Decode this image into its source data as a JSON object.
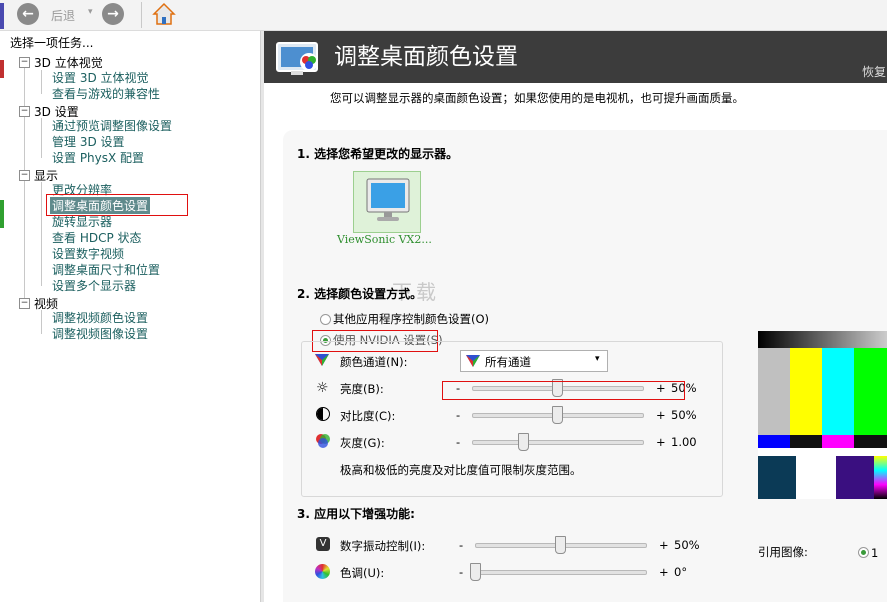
{
  "toolbar": {
    "back_label": "后退"
  },
  "left": {
    "header": "选择一项任务...",
    "categories": [
      {
        "label": "3D 立体视觉",
        "items": [
          "设置 3D 立体视觉",
          "查看与游戏的兼容性"
        ]
      },
      {
        "label": "3D 设置",
        "items": [
          "通过预览调整图像设置",
          "管理 3D 设置",
          "设置 PhysX 配置"
        ]
      },
      {
        "label": "显示",
        "items": [
          "更改分辨率",
          "调整桌面颜色设置",
          "旋转显示器",
          "查看 HDCP 状态",
          "设置数字视频",
          "调整桌面尺寸和位置",
          "设置多个显示器"
        ]
      },
      {
        "label": "视频",
        "items": [
          "调整视频颜色设置",
          "调整视频图像设置"
        ]
      }
    ]
  },
  "right": {
    "title": "调整桌面颜色设置",
    "restore": "恢复",
    "subtitle": "您可以调整显示器的桌面颜色设置；如果您使用的是电视机，也可提升画面质量。",
    "section1": {
      "title": "1. 选择您希望更改的显示器。",
      "display_name": "ViewSonic VX2..."
    },
    "section2": {
      "title": "2. 选择颜色设置方式。",
      "option_other": "其他应用程序控制颜色设置(O)",
      "option_nvidia": "使用 NVIDIA 设置(S)",
      "channel_label": "颜色通道(N):",
      "channel_value": "所有通道",
      "brightness_label": "亮度(B):",
      "brightness_value": "50%",
      "contrast_label": "对比度(C):",
      "contrast_value": "50%",
      "gamma_label": "灰度(G):",
      "gamma_value": "1.00",
      "minus": "-",
      "plus": "+",
      "note": "极高和极低的亮度及对比度值可限制灰度范围。"
    },
    "section3": {
      "title": "3. 应用以下增强功能:",
      "vibrance_label": "数字振动控制(I):",
      "vibrance_value": "50%",
      "hue_label": "色调(U):",
      "hue_value": "0°"
    },
    "reference_label": "引用图像:",
    "reference_option": "1",
    "watermark": "下载"
  },
  "slider_levels": {
    "brightness": 0.5,
    "contrast": 0.5,
    "gamma": 0.3,
    "vibrance": 0.5,
    "hue": 0.0
  }
}
